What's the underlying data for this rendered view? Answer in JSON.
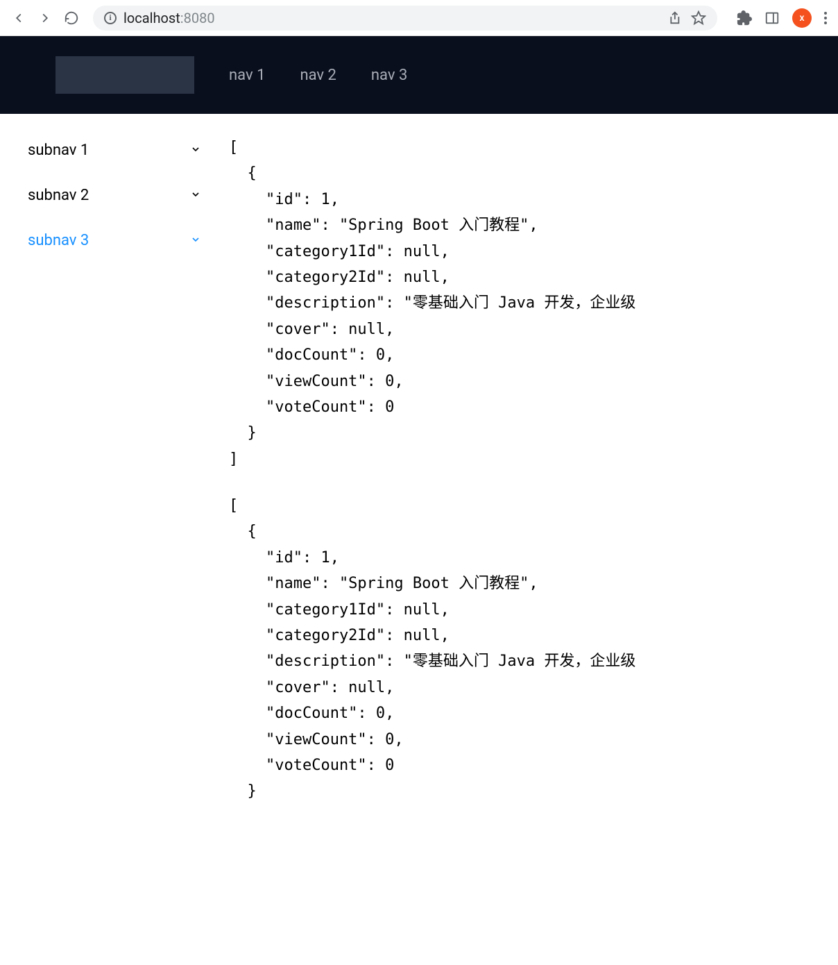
{
  "browser": {
    "url_host": "localhost",
    "url_suffix": ":8080",
    "avatar_letter": "x"
  },
  "header": {
    "nav": [
      "nav 1",
      "nav 2",
      "nav 3"
    ]
  },
  "sidebar": {
    "items": [
      {
        "label": "subnav 1",
        "active": false
      },
      {
        "label": "subnav 2",
        "active": false
      },
      {
        "label": "subnav 3",
        "active": true
      }
    ]
  },
  "content": {
    "json_block_1": "[\n  {\n    \"id\": 1,\n    \"name\": \"Spring Boot 入门教程\",\n    \"category1Id\": null,\n    \"category2Id\": null,\n    \"description\": \"零基础入门 Java 开发，企业级\n    \"cover\": null,\n    \"docCount\": 0,\n    \"viewCount\": 0,\n    \"voteCount\": 0\n  }\n]",
    "json_block_2": "[\n  {\n    \"id\": 1,\n    \"name\": \"Spring Boot 入门教程\",\n    \"category1Id\": null,\n    \"category2Id\": null,\n    \"description\": \"零基础入门 Java 开发，企业级\n    \"cover\": null,\n    \"docCount\": 0,\n    \"viewCount\": 0,\n    \"voteCount\": 0\n  }"
  }
}
